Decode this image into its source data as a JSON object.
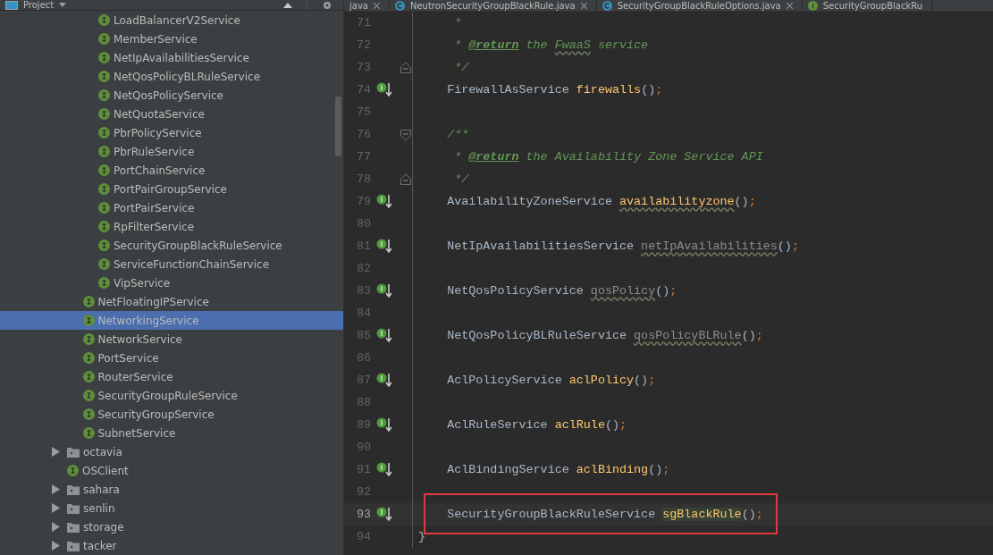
{
  "project_panel": {
    "title": "Project",
    "tree": [
      {
        "children": [
          {
            "children": [
              {
                "label": "LoadBalancerV2Service",
                "kind": "interface",
                "selected": false
              },
              {
                "label": "MemberService",
                "kind": "interface",
                "selected": false
              },
              {
                "label": "NetIpAvailabilitiesService",
                "kind": "interface",
                "selected": false
              },
              {
                "label": "NetQosPolicyBLRuleService",
                "kind": "interface",
                "selected": false
              },
              {
                "label": "NetQosPolicyService",
                "kind": "interface",
                "selected": false
              },
              {
                "label": "NetQuotaService",
                "kind": "interface",
                "selected": false
              },
              {
                "label": "PbrPolicyService",
                "kind": "interface",
                "selected": false
              },
              {
                "label": "PbrRuleService",
                "kind": "interface",
                "selected": false
              },
              {
                "label": "PortChainService",
                "kind": "interface",
                "selected": false
              },
              {
                "label": "PortPairGroupService",
                "kind": "interface",
                "selected": false
              },
              {
                "label": "PortPairService",
                "kind": "interface",
                "selected": false
              },
              {
                "label": "RpFilterService",
                "kind": "interface",
                "selected": false
              },
              {
                "label": "SecurityGroupBlackRuleService",
                "kind": "interface",
                "selected": false
              },
              {
                "label": "ServiceFunctionChainService",
                "kind": "interface",
                "selected": false
              },
              {
                "label": "VipService",
                "kind": "interface",
                "selected": false
              }
            ]
          },
          {
            "label": "NetFloatingIPService",
            "kind": "interface",
            "selected": false
          },
          {
            "label": "NetworkingService",
            "kind": "interface",
            "selected": true
          },
          {
            "label": "NetworkService",
            "kind": "interface",
            "selected": false
          },
          {
            "label": "PortService",
            "kind": "interface",
            "selected": false
          },
          {
            "label": "RouterService",
            "kind": "interface",
            "selected": false
          },
          {
            "label": "SecurityGroupRuleService",
            "kind": "interface",
            "selected": false
          },
          {
            "label": "SecurityGroupService",
            "kind": "interface",
            "selected": false
          },
          {
            "label": "SubnetService",
            "kind": "interface",
            "selected": false
          }
        ]
      },
      {
        "label": "octavia",
        "kind": "package",
        "expanded": false,
        "selected": false
      },
      {
        "label": "OSClient",
        "kind": "interface",
        "selected": false
      },
      {
        "label": "sahara",
        "kind": "package",
        "expanded": false,
        "selected": false
      },
      {
        "label": "senlin",
        "kind": "package",
        "expanded": false,
        "selected": false
      },
      {
        "label": "storage",
        "kind": "package",
        "expanded": false,
        "selected": false
      },
      {
        "label": "tacker",
        "kind": "package",
        "expanded": false,
        "selected": false
      }
    ]
  },
  "tabs": [
    {
      "label": "java",
      "kind": "none",
      "selected": false
    },
    {
      "label": "NeutronSecurityGroupBlackRule.java",
      "kind": "class",
      "selected": false
    },
    {
      "label": "SecurityGroupBlackRuleOptions.java",
      "kind": "class",
      "selected": false
    },
    {
      "label": "SecurityGroupBlackRu",
      "kind": "interface",
      "selected": false
    }
  ],
  "editor": {
    "lines": [
      {
        "number": "71",
        "marker": false,
        "kind": "code",
        "boxed": false,
        "current": false,
        "tokens": [
          {
            "kind": "comment",
            "text": "     *",
            "squiggle": false,
            "highlight": false
          }
        ]
      },
      {
        "number": "72",
        "marker": false,
        "kind": "code",
        "boxed": false,
        "current": false,
        "tokens": [
          {
            "kind": "comment",
            "text": "     * ",
            "squiggle": false,
            "highlight": false
          },
          {
            "kind": "tag",
            "text": "@return",
            "squiggle": false,
            "highlight": false
          },
          {
            "kind": "comment",
            "text": " the ",
            "squiggle": false,
            "highlight": false
          },
          {
            "kind": "comment",
            "text": "FwaaS",
            "squiggle": true,
            "highlight": false
          },
          {
            "kind": "comment",
            "text": " service",
            "squiggle": false,
            "highlight": false
          }
        ]
      },
      {
        "number": "73",
        "marker": false,
        "kind": "fold_end",
        "boxed": false,
        "current": false,
        "tokens": [
          {
            "kind": "comment",
            "text": "     */",
            "squiggle": false,
            "highlight": false
          }
        ]
      },
      {
        "number": "74",
        "marker": true,
        "kind": "code",
        "boxed": false,
        "current": false,
        "tokens": [
          {
            "kind": "plain",
            "text": "    FirewallAsService ",
            "squiggle": false,
            "highlight": false
          },
          {
            "kind": "method",
            "text": "firewalls",
            "squiggle": false,
            "highlight": false
          },
          {
            "kind": "plain",
            "text": "()",
            "squiggle": false,
            "highlight": false
          },
          {
            "kind": "semi",
            "text": ";",
            "squiggle": false,
            "highlight": false
          }
        ]
      },
      {
        "number": "75",
        "marker": false,
        "kind": "blank",
        "boxed": false,
        "current": false
      },
      {
        "number": "76",
        "marker": false,
        "kind": "fold_start",
        "boxed": false,
        "current": false,
        "tokens": [
          {
            "kind": "comment",
            "text": "    /**",
            "squiggle": false,
            "highlight": false
          }
        ]
      },
      {
        "number": "77",
        "marker": false,
        "kind": "code",
        "boxed": false,
        "current": false,
        "tokens": [
          {
            "kind": "comment",
            "text": "     * ",
            "squiggle": false,
            "highlight": false
          },
          {
            "kind": "tag",
            "text": "@return",
            "squiggle": false,
            "highlight": false
          },
          {
            "kind": "comment",
            "text": " the Availability Zone Service API",
            "squiggle": false,
            "highlight": false
          }
        ]
      },
      {
        "number": "78",
        "marker": false,
        "kind": "fold_end",
        "boxed": false,
        "current": false,
        "tokens": [
          {
            "kind": "comment",
            "text": "     */",
            "squiggle": false,
            "highlight": false
          }
        ]
      },
      {
        "number": "79",
        "marker": true,
        "kind": "code",
        "boxed": false,
        "current": false,
        "tokens": [
          {
            "kind": "plain",
            "text": "    AvailabilityZoneService ",
            "squiggle": false,
            "highlight": false
          },
          {
            "kind": "method",
            "text": "availabilityzone",
            "squiggle": true,
            "highlight": false
          },
          {
            "kind": "plain",
            "text": "()",
            "squiggle": false,
            "highlight": false
          },
          {
            "kind": "semi",
            "text": ";",
            "squiggle": false,
            "highlight": false
          }
        ]
      },
      {
        "number": "80",
        "marker": false,
        "kind": "blank",
        "boxed": false,
        "current": false
      },
      {
        "number": "81",
        "marker": true,
        "kind": "code",
        "boxed": false,
        "current": false,
        "tokens": [
          {
            "kind": "plain",
            "text": "    NetIpAvailabilitiesService ",
            "squiggle": false,
            "highlight": false
          },
          {
            "kind": "unused",
            "text": "netIpAvailabilities",
            "squiggle": true,
            "highlight": false
          },
          {
            "kind": "plain",
            "text": "()",
            "squiggle": false,
            "highlight": false
          },
          {
            "kind": "semi",
            "text": ";",
            "squiggle": false,
            "highlight": false
          }
        ]
      },
      {
        "number": "82",
        "marker": false,
        "kind": "blank",
        "boxed": false,
        "current": false
      },
      {
        "number": "83",
        "marker": true,
        "kind": "code",
        "boxed": false,
        "current": false,
        "tokens": [
          {
            "kind": "plain",
            "text": "    NetQosPolicyService ",
            "squiggle": false,
            "highlight": false
          },
          {
            "kind": "unused",
            "text": "qosPolicy",
            "squiggle": true,
            "highlight": false
          },
          {
            "kind": "plain",
            "text": "()",
            "squiggle": false,
            "highlight": false
          },
          {
            "kind": "semi",
            "text": ";",
            "squiggle": false,
            "highlight": false
          }
        ]
      },
      {
        "number": "84",
        "marker": false,
        "kind": "blank",
        "boxed": false,
        "current": false
      },
      {
        "number": "85",
        "marker": true,
        "kind": "code",
        "boxed": false,
        "current": false,
        "tokens": [
          {
            "kind": "plain",
            "text": "    NetQosPolicyBLRuleService ",
            "squiggle": false,
            "highlight": false
          },
          {
            "kind": "unused",
            "text": "qosPolicyBLRule",
            "squiggle": true,
            "highlight": false
          },
          {
            "kind": "plain",
            "text": "()",
            "squiggle": false,
            "highlight": false
          },
          {
            "kind": "semi",
            "text": ";",
            "squiggle": false,
            "highlight": false
          }
        ]
      },
      {
        "number": "86",
        "marker": false,
        "kind": "blank",
        "boxed": false,
        "current": false
      },
      {
        "number": "87",
        "marker": true,
        "kind": "code",
        "boxed": false,
        "current": false,
        "tokens": [
          {
            "kind": "plain",
            "text": "    AclPolicyService ",
            "squiggle": false,
            "highlight": false
          },
          {
            "kind": "method",
            "text": "aclPolicy",
            "squiggle": false,
            "highlight": false
          },
          {
            "kind": "plain",
            "text": "()",
            "squiggle": false,
            "highlight": false
          },
          {
            "kind": "semi",
            "text": ";",
            "squiggle": false,
            "highlight": false
          }
        ]
      },
      {
        "number": "88",
        "marker": false,
        "kind": "blank",
        "boxed": false,
        "current": false
      },
      {
        "number": "89",
        "marker": true,
        "kind": "code",
        "boxed": false,
        "current": false,
        "tokens": [
          {
            "kind": "plain",
            "text": "    AclRuleService ",
            "squiggle": false,
            "highlight": false
          },
          {
            "kind": "method",
            "text": "aclRule",
            "squiggle": false,
            "highlight": false
          },
          {
            "kind": "plain",
            "text": "()",
            "squiggle": false,
            "highlight": false
          },
          {
            "kind": "semi",
            "text": ";",
            "squiggle": false,
            "highlight": false
          }
        ]
      },
      {
        "number": "90",
        "marker": false,
        "kind": "blank",
        "boxed": false,
        "current": false
      },
      {
        "number": "91",
        "marker": true,
        "kind": "code",
        "boxed": false,
        "current": false,
        "tokens": [
          {
            "kind": "plain",
            "text": "    AclBindingService ",
            "squiggle": false,
            "highlight": false
          },
          {
            "kind": "method",
            "text": "aclBinding",
            "squiggle": false,
            "highlight": false
          },
          {
            "kind": "plain",
            "text": "()",
            "squiggle": false,
            "highlight": false
          },
          {
            "kind": "semi",
            "text": ";",
            "squiggle": false,
            "highlight": false
          }
        ]
      },
      {
        "number": "92",
        "marker": false,
        "kind": "blank",
        "boxed": false,
        "current": false
      },
      {
        "number": "93",
        "marker": true,
        "kind": "code",
        "boxed": true,
        "current": true,
        "tokens": [
          {
            "kind": "plain",
            "text": "    SecurityGroupBlackRuleService ",
            "squiggle": false,
            "highlight": false
          },
          {
            "kind": "method",
            "text": "sgBlackRule",
            "squiggle": false,
            "highlight": true
          },
          {
            "kind": "plain",
            "text": "()",
            "squiggle": false,
            "highlight": false
          },
          {
            "kind": "semi",
            "text": ";",
            "squiggle": false,
            "highlight": false
          }
        ]
      },
      {
        "number": "94",
        "marker": false,
        "kind": "code",
        "boxed": false,
        "current": false,
        "tokens": [
          {
            "kind": "plain",
            "text": "}",
            "squiggle": false,
            "highlight": false
          }
        ]
      }
    ]
  }
}
